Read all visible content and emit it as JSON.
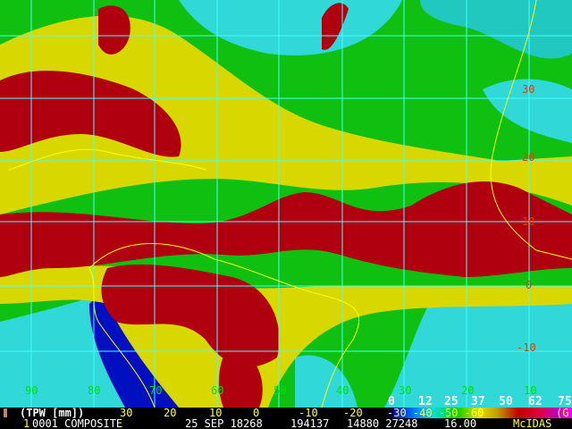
{
  "product": "(TPW [mm])",
  "frame_number": "1",
  "title_line": "0001 COMPOSITE",
  "date": "25 SEP 18268",
  "time": "194137",
  "line_elem": "14880 27248",
  "res": "16.00",
  "brand": "McIDAS",
  "bottom_lon_labels": [
    "30",
    "20",
    "10",
    "0",
    "-10",
    "-20",
    "-30 -40 -50 -60"
  ],
  "bottom_right_label": "(G",
  "longitude_labels": [
    "90",
    "80",
    "70",
    "60",
    "50",
    "40",
    "30",
    "20",
    "10"
  ],
  "latitude_labels": [
    "30",
    "20",
    "10",
    "0",
    "-10"
  ],
  "colorbar": {
    "ticks": [
      "0",
      "12",
      "25",
      "37",
      "50",
      "62",
      "75"
    ],
    "colors": [
      "#0000c0",
      "#00c0ff",
      "#00e000",
      "#e0e000",
      "#c00000",
      "#c000c0"
    ]
  },
  "colors": {
    "grid": "#40ffff",
    "coast": "#ffff00",
    "green": "#00c000",
    "yellow": "#d8d800",
    "red": "#b00010",
    "cyan": "#30d8d8",
    "blue": "#0010c0"
  }
}
